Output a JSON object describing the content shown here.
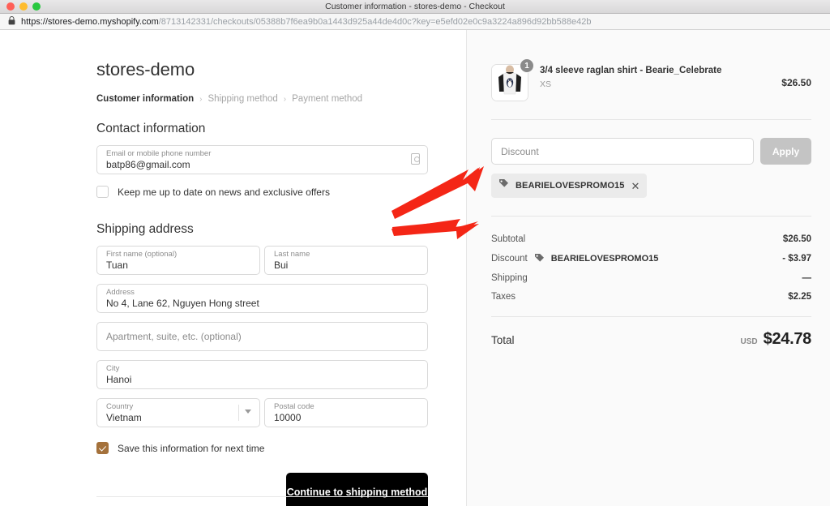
{
  "window": {
    "title": "Customer information - stores-demo - Checkout",
    "lock_icon": "lock-icon",
    "url_secure_part": "https://stores-demo.myshopify.com",
    "url_path_part": "/8713142331/checkouts/05388b7f6ea9b0a1443d925a44de4d0c?key=e5efd02e0c9a3224a896d92bb588e42b"
  },
  "checkout": {
    "shop_name": "stores-demo",
    "breadcrumb": [
      {
        "label": "Customer information",
        "active": true
      },
      {
        "label": "Shipping method",
        "active": false
      },
      {
        "label": "Payment method",
        "active": false
      }
    ],
    "breadcrumb_separator": "›",
    "contact": {
      "heading": "Contact information",
      "email_label": "Email or mobile phone number",
      "email_value": "batp86@gmail.com",
      "autofill_icon": "contact-card-icon",
      "newsletter_label": "Keep me up to date on news and exclusive offers",
      "newsletter_checked": false
    },
    "shipping": {
      "heading": "Shipping address",
      "first_name_label": "First name (optional)",
      "first_name_value": "Tuan",
      "last_name_label": "Last name",
      "last_name_value": "Bui",
      "address_label": "Address",
      "address_value": "No 4, Lane 62, Nguyen Hong street",
      "apartment_placeholder": "Apartment, suite, etc. (optional)",
      "city_label": "City",
      "city_value": "Hanoi",
      "country_label": "Country",
      "country_value": "Vietnam",
      "postal_label": "Postal code",
      "postal_value": "10000",
      "save_info_label": "Save this information for next time",
      "save_info_checked": true,
      "save_info_color": "#a4713b"
    },
    "continue_button": "Continue to shipping method"
  },
  "summary": {
    "item": {
      "title": "3/4 sleeve raglan shirt - Bearie_Celebrate",
      "variant": "XS",
      "quantity": "1",
      "price": "$26.50",
      "image_icon": "raglan-shirt-thumbnail"
    },
    "discount": {
      "placeholder": "Discount",
      "value": "",
      "apply_label": "Apply",
      "applied_code": "BEARIELOVESPROMO15",
      "tag_icon": "tag-icon",
      "remove_icon": "close-icon"
    },
    "totals": [
      {
        "label": "Subtotal",
        "code": "",
        "value": "$26.50"
      },
      {
        "label": "Discount",
        "code": "BEARIELOVESPROMO15",
        "value": "- $3.97"
      },
      {
        "label": "Shipping",
        "code": "",
        "value": "—"
      },
      {
        "label": "Taxes",
        "code": "",
        "value": "$2.25"
      }
    ],
    "total": {
      "label": "Total",
      "currency": "USD",
      "amount": "$24.78"
    }
  },
  "annotations": {
    "arrow_color": "#f42616",
    "arrow_upper_target": "discount-code-pill",
    "arrow_lower_target": "discount-total-row"
  }
}
